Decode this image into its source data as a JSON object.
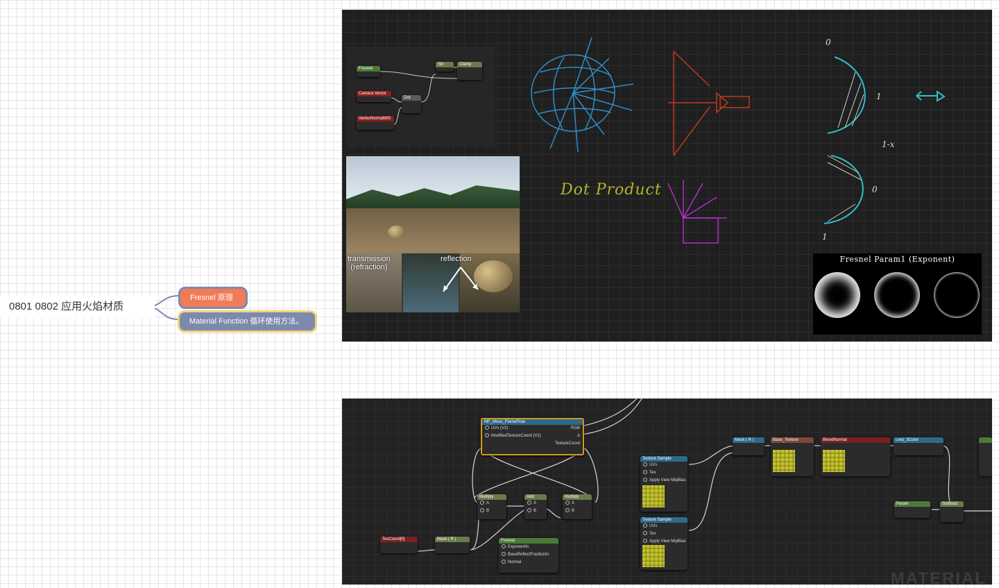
{
  "mindmap": {
    "root_label": "0801 0802 应用火焰材质",
    "subtopics": [
      {
        "label": "Fresnel 原理"
      },
      {
        "label": "Material Function 循环使用方法。"
      }
    ]
  },
  "panel1": {
    "mini_graph_nodes": [
      "Fresnel",
      "Camera Vector",
      "VertexNormalWS",
      "Dot",
      "Clamp",
      "Sin"
    ],
    "photo_captions": {
      "transmission": "transmission\n(refraction)",
      "reflection": "reflection"
    },
    "dot_product_label": "Dot Product",
    "hand_labels": {
      "zero_top": "0",
      "one_top": "1",
      "one_minus_x": "1-x",
      "zero_bottom": "0",
      "one_bottom": "1"
    },
    "fresnel_title": "Fresnel Param1 (Exponent)"
  },
  "panel2": {
    "nodes": {
      "flow": {
        "title": "MF_Moss_FlameFlow",
        "rows": [
          "UVs (V2)",
          "ModifiedTextureCoord (V2)"
        ],
        "outputs": [
          "RGB",
          "A",
          "TextureCoord"
        ]
      },
      "multiply1": {
        "title": "Multiply",
        "rows": [
          "A",
          "B"
        ]
      },
      "add": {
        "title": "Add",
        "rows": [
          "A",
          "B"
        ]
      },
      "multiply2": {
        "title": "Multiply",
        "rows": [
          "A",
          "B"
        ]
      },
      "texcoord": {
        "title": "TexCoord[0]"
      },
      "mask": {
        "title": "Mask ( R )"
      },
      "fresnel": {
        "title": "Fresnel",
        "rows": [
          "ExponentIn",
          "BaseReflectFractionIn",
          "Normal"
        ]
      },
      "texsample1": {
        "title": "Texture Sample",
        "rows": [
          "UVs",
          "Tex",
          "Apply View MipBias"
        ]
      },
      "texsample2": {
        "title": "Texture Sample",
        "rows": [
          "UVs",
          "Tex",
          "Apply View MipBias"
        ]
      },
      "mask2": {
        "title": "Mask ( R )"
      },
      "n3": {
        "title": "Base_Texture"
      },
      "n4": {
        "title": "BlendNormal"
      },
      "n5": {
        "title": "Lerp_3Color"
      },
      "n6": {
        "title": "Param"
      },
      "n7": {
        "title": "Subtract"
      }
    },
    "watermark": "MATERIAL"
  }
}
